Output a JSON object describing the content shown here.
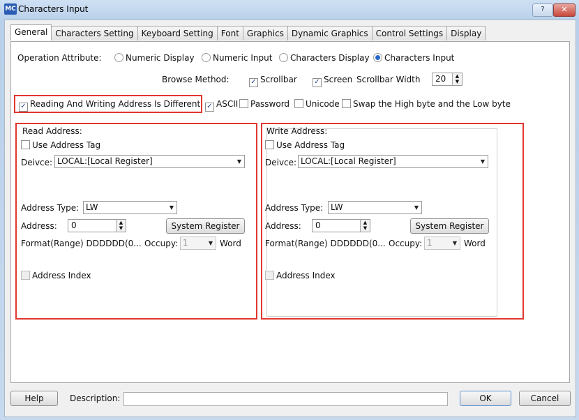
{
  "window": {
    "title": "Characters Input",
    "app_icon": "MC"
  },
  "tabs": [
    "General",
    "Characters Setting",
    "Keyboard Setting",
    "Font",
    "Graphics",
    "Dynamic Graphics",
    "Control Settings",
    "Display"
  ],
  "operation": {
    "label": "Operation Attribute:",
    "options": [
      "Numeric Display",
      "Numeric Input",
      "Characters Display",
      "Characters Input"
    ],
    "selected": "Characters Input"
  },
  "browse": {
    "label": "Browse Method:",
    "scrollbar": "Scrollbar",
    "screen": "Screen",
    "width_label": "Scrollbar Width",
    "width_value": "20"
  },
  "options_row": {
    "rw_diff": "Reading And Writing Address Is Different",
    "ascii": "ASCII",
    "password": "Password",
    "unicode": "Unicode",
    "swap": "Swap the High byte and the Low byte"
  },
  "read": {
    "title": "Read Address:",
    "use_tag": "Use Address Tag",
    "device_label": "Deivce:",
    "device_value": "LOCAL:[Local Register]",
    "type_label": "Address Type:",
    "type_value": "LW",
    "address_label": "Address:",
    "address_value": "0",
    "sysreg": "System Register",
    "format": "Format(Range) DDDDDD(0...",
    "occupy_label": "Occupy:",
    "occupy_value": "1",
    "word": "Word",
    "index": "Address Index"
  },
  "write": {
    "title": "Write Address:",
    "use_tag": "Use Address Tag",
    "device_label": "Deivce:",
    "device_value": "LOCAL:[Local Register]",
    "type_label": "Address Type:",
    "type_value": "LW",
    "address_label": "Address:",
    "address_value": "0",
    "sysreg": "System Register",
    "format": "Format(Range) DDDDDD(0...",
    "occupy_label": "Occupy:",
    "occupy_value": "1",
    "word": "Word",
    "index": "Address Index"
  },
  "footer": {
    "help": "Help",
    "description": "Description:",
    "ok": "OK",
    "cancel": "Cancel"
  },
  "colors": {
    "highlight": "#e2372f",
    "accent": "#2767c9"
  }
}
